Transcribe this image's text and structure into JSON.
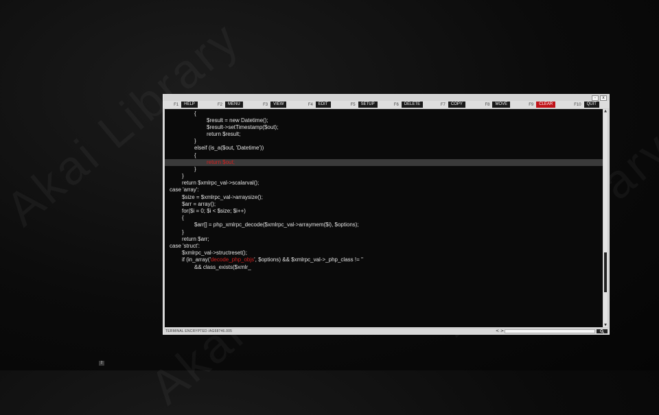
{
  "watermark": "Akai Library",
  "window": {
    "minimize_glyph": "-",
    "close_glyph": "x"
  },
  "fkeys": [
    {
      "key": "F1",
      "label": "HELP",
      "color": "#1a1a1a"
    },
    {
      "key": "F2",
      "label": "MENU",
      "color": "#1a1a1a"
    },
    {
      "key": "F3",
      "label": "VIEW",
      "color": "#1a1a1a"
    },
    {
      "key": "F4",
      "label": "EDIT",
      "color": "#1a1a1a"
    },
    {
      "key": "F5",
      "label": "SETUP",
      "color": "#1a1a1a"
    },
    {
      "key": "F6",
      "label": "DELETE",
      "color": "#1a1a1a"
    },
    {
      "key": "F7",
      "label": "COPY",
      "color": "#1a1a1a"
    },
    {
      "key": "F8",
      "label": "MOVE",
      "color": "#1a1a1a"
    },
    {
      "key": "F9",
      "label": "CLEAR",
      "color": "#c0141a"
    },
    {
      "key": "F10",
      "label": "QUIT",
      "color": "#1a1a1a"
    }
  ],
  "code": {
    "line_01": "{",
    "line_02": "$result = new Datetime();",
    "line_03": "$result->setTimestamp($out);",
    "line_04": "return $result;",
    "line_05": "}",
    "line_06": "elseif (is_a($out, 'Datetime'))",
    "line_07": "{",
    "line_08": "return $out;",
    "line_09": "}",
    "line_10": "}",
    "line_11": "return $xmlrpc_val->scalarval();",
    "line_12": "case 'array':",
    "line_13": "$size = $xmlrpc_val->arraysize();",
    "line_14": "$arr = array();",
    "line_15": "for($i = 0; $i < $size; $i++)",
    "line_16": "{",
    "line_17": "$arr[] = php_xmlrpc_decode($xmlrpc_val->arraymem($i), $options);",
    "line_18": "}",
    "line_19": "return $arr;",
    "line_20": "case 'struct':",
    "line_21": "$xmlrpc_val->structreset();",
    "line_22a": "if (in_array('",
    "line_22b": "decode_php_objs",
    "line_22c": "', $options) && $xmlrpc_val->_php_class != ''",
    "line_23": "&& class_exists($xmlr_"
  },
  "scrollbar": {
    "position_fraction": 0.82
  },
  "status": {
    "text": "TERMINAL ENCRYPTED  /AG68746.005",
    "nav_prev": "<",
    "nav_next": ">",
    "search_icon": "search-icon"
  },
  "page_badge": "2",
  "colors": {
    "highlight_text": "#d2201f",
    "clear_key": "#c0141a",
    "editor_bg": "#0a0a0a",
    "highlight_line_bg": "#3a3a3a"
  }
}
